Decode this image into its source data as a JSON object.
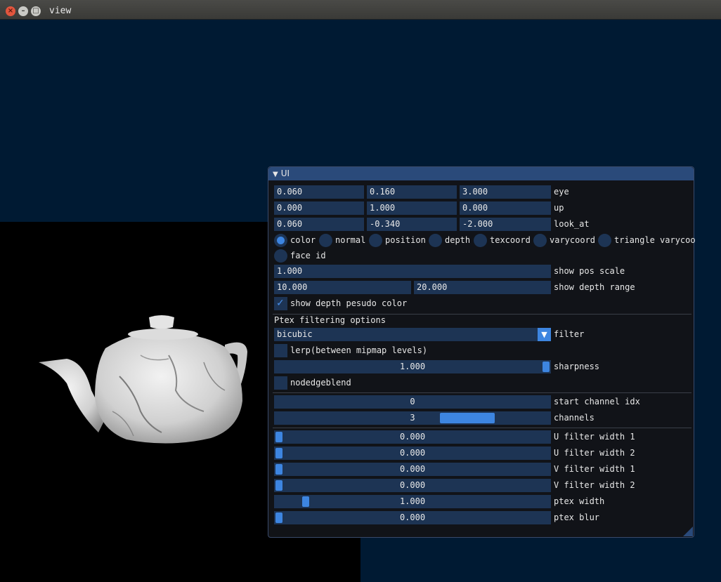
{
  "window": {
    "title": "view"
  },
  "panel": {
    "title": "UI",
    "eye": {
      "values": [
        "0.060",
        "0.160",
        "3.000"
      ],
      "label": "eye"
    },
    "up": {
      "values": [
        "0.000",
        "1.000",
        "0.000"
      ],
      "label": "up"
    },
    "look_at": {
      "values": [
        "0.060",
        "-0.340",
        "-2.000"
      ],
      "label": "look_at"
    },
    "modes": [
      "color",
      "normal",
      "position",
      "depth",
      "texcoord",
      "varycoord",
      "triangle varycoo",
      "face id"
    ],
    "selected_mode": "color",
    "show_pos_scale": {
      "value": "1.000",
      "label": "show pos scale"
    },
    "show_depth_range": {
      "values": [
        "10.000",
        "20.000"
      ],
      "label": "show depth range"
    },
    "show_depth_pseudo_color": {
      "label": "show depth pesudo color",
      "checked": true
    },
    "ptex_header": "Ptex filtering options",
    "filter": {
      "value": "bicubic",
      "label": "filter"
    },
    "lerp": {
      "label": "lerp(between mipmap levels)",
      "checked": false
    },
    "sharpness": {
      "value": "1.000",
      "label": "sharpness",
      "level": 1.0
    },
    "nodedgeblend": {
      "label": "nodedgeblend",
      "checked": false
    },
    "start_channel": {
      "value": "0",
      "label": "start channel idx"
    },
    "channels": {
      "value": "3",
      "label": "channels"
    },
    "sliders": [
      {
        "value": "0.000",
        "label": "U filter width 1",
        "level": 0.0
      },
      {
        "value": "0.000",
        "label": "U filter width 2",
        "level": 0.0
      },
      {
        "value": "0.000",
        "label": "V filter width 1",
        "level": 0.0
      },
      {
        "value": "0.000",
        "label": "V filter width 2",
        "level": 0.0
      },
      {
        "value": "1.000",
        "label": "ptex width",
        "level": 0.1
      },
      {
        "value": "0.000",
        "label": "ptex blur",
        "level": 0.0
      }
    ]
  },
  "colors": {
    "background": "#001a33",
    "accent": "#3d85e0",
    "frame_bg": "#1d3454",
    "header": "#2a4a7a"
  }
}
